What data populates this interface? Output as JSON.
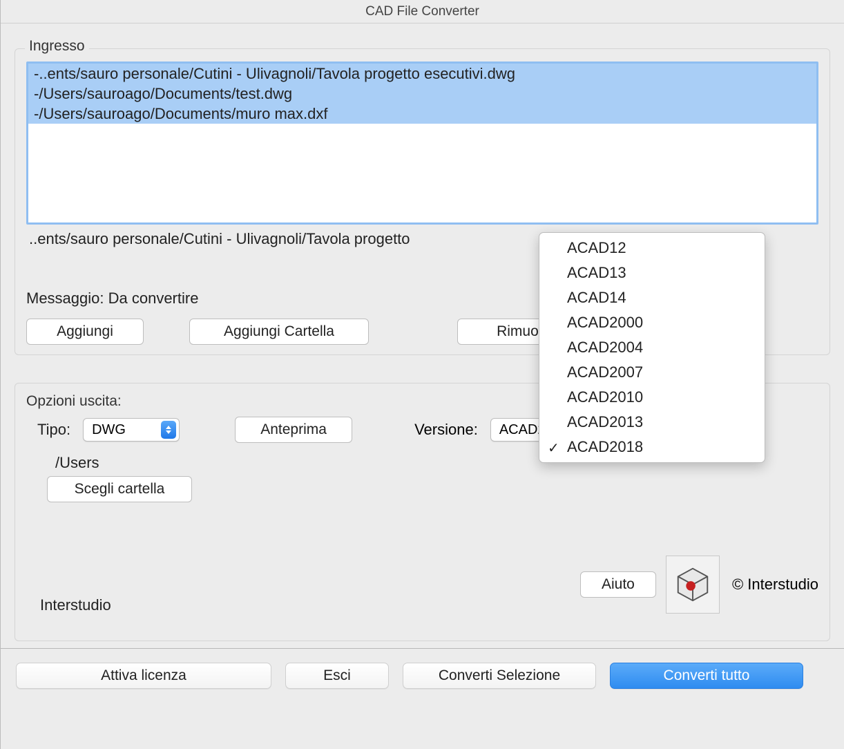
{
  "window": {
    "title": "CAD File Converter"
  },
  "ingresso": {
    "label": "Ingresso",
    "files": [
      "-..ents/sauro personale/Cutini - Ulivagnoli/Tavola progetto esecutivi.dwg",
      "-/Users/sauroago/Documents/test.dwg",
      "-/Users/sauroago/Documents/muro max.dxf"
    ],
    "selected_path": "..ents/sauro personale/Cutini - Ulivagnoli/Tavola progetto",
    "message": "Messaggio: Da convertire",
    "buttons": {
      "add": "Aggiungi",
      "add_folder": "Aggiungi Cartella",
      "remove": "Rimuovi"
    }
  },
  "options": {
    "label": "Opzioni uscita:",
    "type_label": "Tipo:",
    "type_value": "DWG",
    "preview": "Anteprima",
    "version_label": "Versione:",
    "version_value": "ACAD2018",
    "choose_folder": "Scegli cartella",
    "folder_path": "/Users"
  },
  "version_dropdown": {
    "options": [
      "ACAD12",
      "ACAD13",
      "ACAD14",
      "ACAD2000",
      "ACAD2004",
      "ACAD2007",
      "ACAD2010",
      "ACAD2013",
      "ACAD2018"
    ],
    "selected": "ACAD2018"
  },
  "footer": {
    "vendor": "Interstudio",
    "help": "Aiuto",
    "copyright": "© Interstudio"
  },
  "bottom": {
    "license": "Attiva licenza",
    "exit": "Esci",
    "convert_selection": "Converti Selezione",
    "convert_all": "Converti tutto"
  }
}
